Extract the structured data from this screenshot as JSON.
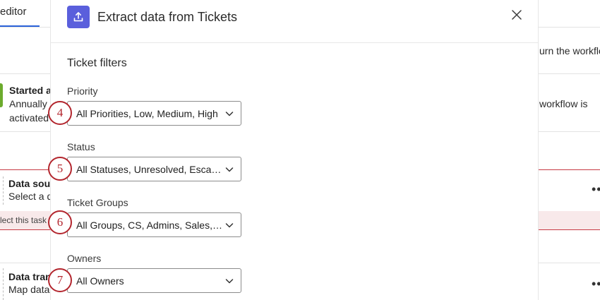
{
  "background": {
    "tab_label": "editor",
    "right_text_1": "urn the workflo",
    "right_text_2": "workflow is",
    "started_title": "Started a",
    "started_sub_1": "Annually",
    "started_sub_2": "activated",
    "source_title": "Data sou",
    "source_sub": "Select a d",
    "alert_text": "lect this task",
    "transform_title": "Data tran",
    "transform_sub": "Map data",
    "more_dots": "••"
  },
  "modal": {
    "title": "Extract data from Tickets",
    "icon": "upload-icon",
    "close_icon": "close-icon",
    "section_title": "Ticket filters",
    "accent_color": "#5a5fdc",
    "fields": [
      {
        "label": "Priority",
        "value": "All Priorities, Low, Medium, High",
        "step": "4"
      },
      {
        "label": "Status",
        "value": "All Statuses, Unresolved, Escal…",
        "step": "5"
      },
      {
        "label": "Ticket Groups",
        "value": "All Groups, CS, Admins, Sales,…",
        "step": "6"
      },
      {
        "label": "Owners",
        "value": "All Owners",
        "step": "7"
      }
    ]
  },
  "step_color": "#b3262e"
}
